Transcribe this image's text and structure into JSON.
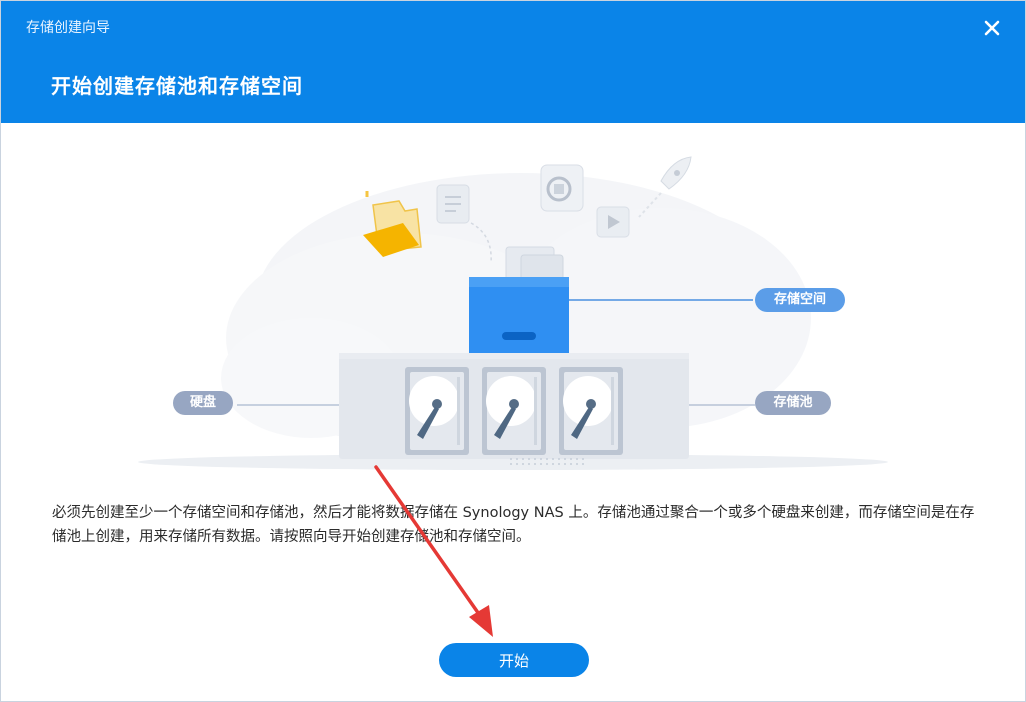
{
  "window": {
    "title": "存储创建向导"
  },
  "header": {
    "title": "开始创建存储池和存储空间"
  },
  "illustration": {
    "label_volume": "存储空间",
    "label_disk": "硬盘",
    "label_pool": "存储池"
  },
  "description": "必须先创建至少一个存储空间和存储池，然后才能将数据存储在 Synology NAS 上。存储池通过聚合一个或多个硬盘来创建，而存储空间是在存储池上创建，用来存储所有数据。请按照向导开始创建存储池和存储空间。",
  "buttons": {
    "start": "开始"
  },
  "colors": {
    "accent": "#0a84e8",
    "pill": "#93a5c8",
    "pill_volume": "#5b9de8",
    "annotation_arrow": "#e53935"
  },
  "icons": [
    "close-icon",
    "folder-icon",
    "document-icon",
    "synology-logo-icon",
    "video-icon",
    "rocket-icon",
    "volume-box-icon",
    "hard-disk-icon"
  ]
}
